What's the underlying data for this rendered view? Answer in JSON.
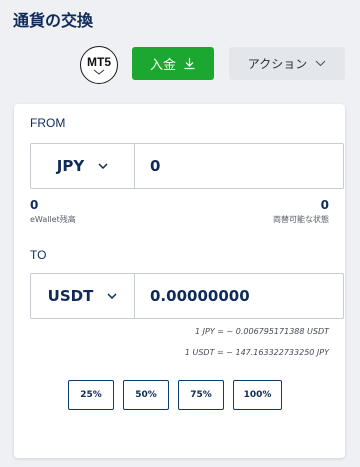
{
  "page": {
    "title": "通貨の交換"
  },
  "header": {
    "platform_badge": "MT5",
    "deposit_label": "入金",
    "action_label": "アクション"
  },
  "from": {
    "label": "FROM",
    "currency": "JPY",
    "amount": "0",
    "ewallet_balance": "0",
    "ewallet_caption": "eWallet残高",
    "exchangeable_balance": "0",
    "exchangeable_caption": "両替可能な状態"
  },
  "to": {
    "label": "TO",
    "currency": "USDT",
    "amount": "0.00000000"
  },
  "rates": {
    "jpy_to_usdt": "1 JPY = ~ 0.006795171388 USDT",
    "usdt_to_jpy": "1 USDT = ~ 147.163322733250 JPY"
  },
  "percent_buttons": [
    "25%",
    "50%",
    "75%",
    "100%"
  ],
  "colors": {
    "accent": "#1ca830",
    "text": "#0f2b58"
  },
  "icons": {
    "platform": "chevron-down-icon",
    "deposit": "download-icon",
    "action": "chevron-down-icon",
    "currency_select": "chevron-down-icon"
  }
}
